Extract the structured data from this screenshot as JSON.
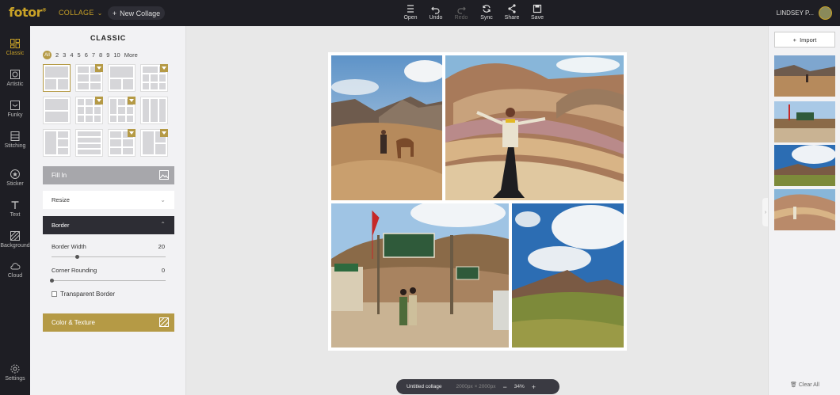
{
  "topbar": {
    "logo": "fotor",
    "logo_mark": "®",
    "mode_label": "COLLAGE",
    "new_collage_label": "New Collage",
    "tools": [
      {
        "label": "Open",
        "icon": "menu-icon",
        "enabled": true
      },
      {
        "label": "Undo",
        "icon": "undo-icon",
        "enabled": true
      },
      {
        "label": "Redo",
        "icon": "redo-icon",
        "enabled": false
      },
      {
        "label": "Sync",
        "icon": "sync-icon",
        "enabled": true
      },
      {
        "label": "Share",
        "icon": "share-icon",
        "enabled": true
      },
      {
        "label": "Save",
        "icon": "save-icon",
        "enabled": true
      }
    ],
    "user_name": "LINDSEY P..."
  },
  "rail": {
    "items": [
      {
        "label": "Classic",
        "icon": "layout-icon",
        "active": true
      },
      {
        "label": "Artistic",
        "icon": "artistic-icon",
        "active": false
      },
      {
        "label": "Funky",
        "icon": "funky-icon",
        "active": false
      },
      {
        "label": "Stitching",
        "icon": "stitching-icon",
        "active": false
      },
      {
        "label": "Sticker",
        "icon": "sticker-icon",
        "active": false
      },
      {
        "label": "Text",
        "icon": "text-icon",
        "active": false
      },
      {
        "label": "Background",
        "icon": "background-icon",
        "active": false
      },
      {
        "label": "Cloud",
        "icon": "cloud-icon",
        "active": false
      },
      {
        "label": "Settings",
        "icon": "gear-icon",
        "active": false
      }
    ]
  },
  "panel": {
    "title": "CLASSIC",
    "filters": [
      "All",
      "2",
      "3",
      "4",
      "5",
      "6",
      "7",
      "8",
      "9",
      "10",
      "More"
    ],
    "fill_in_label": "Fill In",
    "resize_label": "Resize",
    "border_label": "Border",
    "border_width_label": "Border Width",
    "border_width_value": "20",
    "border_width_fraction": 0.22,
    "corner_rounding_label": "Corner Rounding",
    "corner_rounding_value": "0",
    "corner_rounding_fraction": 0.0,
    "transparent_border_label": "Transparent Border",
    "color_texture_label": "Color & Texture"
  },
  "status": {
    "name": "Untitled collage",
    "dims": "2000px × 2000px",
    "zoom": "34%"
  },
  "right": {
    "import_label": "Import",
    "clear_label": "Clear All"
  },
  "colors": {
    "accent": "#b59a45",
    "dark": "#1e1e24"
  }
}
